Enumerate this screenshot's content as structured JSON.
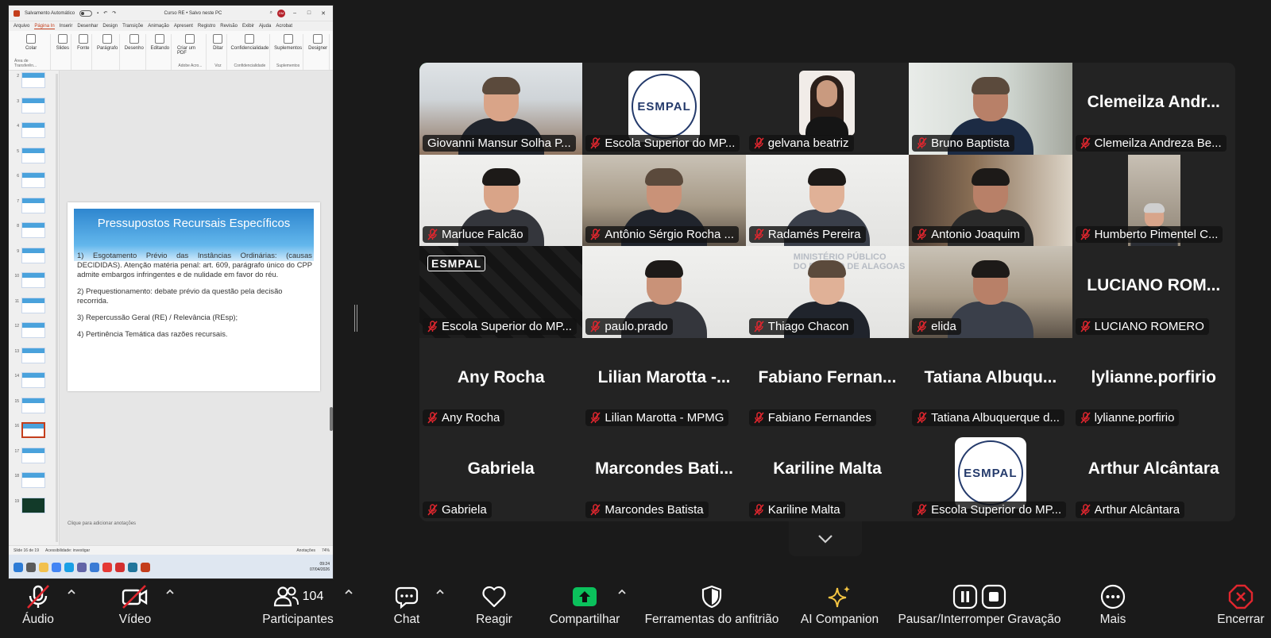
{
  "powerpoint": {
    "title_bar": {
      "autosave_label": "Salvamento Automático",
      "doc_title": "Curso RE • Salvo neste PC",
      "user_initials": "GM"
    },
    "menu_tabs": [
      "Arquivo",
      "Página In",
      "Inserir",
      "Desenhar",
      "Design",
      "Transiçõe",
      "Animação",
      "Apresent",
      "Registro",
      "Revisão",
      "Exibir",
      "Ajuda",
      "Acrobat"
    ],
    "ribbon_groups": [
      {
        "label": "Colar",
        "caption": "Área de Transferên..."
      },
      {
        "label": "Slides",
        "caption": ""
      },
      {
        "label": "Fonte",
        "caption": ""
      },
      {
        "label": "Parágrafo",
        "caption": ""
      },
      {
        "label": "Desenho",
        "caption": ""
      },
      {
        "label": "Editando",
        "caption": ""
      },
      {
        "label": "Criar um PDF",
        "caption": "Adobe Acro..."
      },
      {
        "label": "Ditar",
        "caption": "Voz"
      },
      {
        "label": "Confidencialidade",
        "caption": "Confidencialidade"
      },
      {
        "label": "Suplementos",
        "caption": "Suplementos"
      },
      {
        "label": "Designer",
        "caption": ""
      }
    ],
    "slide_numbers": [
      "2",
      "3",
      "4",
      "5",
      "6",
      "7",
      "8",
      "9",
      "10",
      "11",
      "12",
      "13",
      "14",
      "15",
      "16",
      "17",
      "18",
      "19"
    ],
    "selected_slide": "16",
    "slide": {
      "title": "Pressupostos Recursais Específicos",
      "items": [
        "1) Esgotamento Prévio das Instâncias Ordinárias: (causas DECIDIDAS). Atenção matéria penal: art. 609, parágrafo único do CPP admite embargos infringentes e de nulidade em favor do réu.",
        "2) Prequestionamento: debate prévio da questão pela decisão recorrida.",
        "3) Repercussão Geral (RE) / Relevância (REsp);",
        "4) Pertinência Temática das razões recursais."
      ]
    },
    "notes_placeholder": "Clique para adicionar anotações",
    "status_bar": {
      "slide_counter": "Slide 16 de 19",
      "accessibility": "Acessibilidade: investigar",
      "notes": "Anotações",
      "zoom": "74%"
    },
    "taskbar_clock": {
      "time": "09:24",
      "date": "07/04/2026"
    }
  },
  "gallery": {
    "tiles": [
      {
        "name": "Giovanni Mansur Solha P...",
        "muted": false,
        "active": true,
        "kind": "video",
        "style": "v-office",
        "display": ""
      },
      {
        "name": "Escola Superior do MP...",
        "muted": true,
        "active": false,
        "kind": "logo",
        "style": "",
        "display": ""
      },
      {
        "name": "gelvana beatriz",
        "muted": true,
        "active": false,
        "kind": "photo",
        "style": "",
        "display": ""
      },
      {
        "name": "Bruno Baptista",
        "muted": true,
        "active": false,
        "kind": "video",
        "style": "v-window",
        "display": ""
      },
      {
        "name": "Clemeilza Andreza Be...",
        "muted": true,
        "active": false,
        "kind": "text",
        "style": "",
        "display": "Clemeilza  Andr..."
      },
      {
        "name": "Marluce Falcão",
        "muted": true,
        "active": false,
        "kind": "video",
        "style": "v-white",
        "display": ""
      },
      {
        "name": "Antônio Sérgio Rocha ...",
        "muted": true,
        "active": false,
        "kind": "video",
        "style": "v-room",
        "display": ""
      },
      {
        "name": "Radamés Pereira",
        "muted": true,
        "active": false,
        "kind": "video",
        "style": "v-white",
        "display": ""
      },
      {
        "name": "Antonio Joaquim",
        "muted": true,
        "active": false,
        "kind": "video",
        "style": "v-books",
        "display": ""
      },
      {
        "name": "Humberto Pimentel C...",
        "muted": true,
        "active": false,
        "kind": "small-video",
        "style": "",
        "display": ""
      },
      {
        "name": "Escola Superior do MP...",
        "muted": true,
        "active": false,
        "kind": "esmpal-bg",
        "style": "",
        "display": ""
      },
      {
        "name": "paulo.prado",
        "muted": true,
        "active": false,
        "kind": "video",
        "style": "v-white",
        "display": ""
      },
      {
        "name": "Thiago Chacon",
        "muted": true,
        "active": false,
        "kind": "mp-video",
        "style": "v-white",
        "display": ""
      },
      {
        "name": "elida",
        "muted": true,
        "active": false,
        "kind": "video",
        "style": "v-room",
        "display": ""
      },
      {
        "name": "LUCIANO ROMERO",
        "muted": true,
        "active": false,
        "kind": "text",
        "style": "",
        "display": "LUCIANO  ROM..."
      },
      {
        "name": "Any Rocha",
        "muted": true,
        "active": false,
        "kind": "text",
        "style": "",
        "display": "Any Rocha"
      },
      {
        "name": "Lilian Marotta - MPMG",
        "muted": true,
        "active": false,
        "kind": "text",
        "style": "",
        "display": "Lilian  Marotta  -..."
      },
      {
        "name": "Fabiano Fernandes",
        "muted": true,
        "active": false,
        "kind": "text",
        "style": "",
        "display": "Fabiano  Fernan..."
      },
      {
        "name": "Tatiana Albuquerque d...",
        "muted": true,
        "active": false,
        "kind": "text",
        "style": "",
        "display": "Tatiana  Albuqu..."
      },
      {
        "name": "lylianne.porfirio",
        "muted": true,
        "active": false,
        "kind": "text",
        "style": "",
        "display": "lylianne.porfirio"
      },
      {
        "name": "Gabriela",
        "muted": true,
        "active": false,
        "kind": "text",
        "style": "",
        "display": "Gabriela"
      },
      {
        "name": "Marcondes Batista",
        "muted": true,
        "active": false,
        "kind": "text",
        "style": "",
        "display": "Marcondes  Bati..."
      },
      {
        "name": "Kariline Malta",
        "muted": true,
        "active": false,
        "kind": "text",
        "style": "",
        "display": "Kariline Malta"
      },
      {
        "name": "Escola Superior do MP...",
        "muted": true,
        "active": false,
        "kind": "logo",
        "style": "",
        "display": ""
      },
      {
        "name": "Arthur Alcântara",
        "muted": true,
        "active": false,
        "kind": "text",
        "style": "",
        "display": "Arthur Alcântara"
      }
    ],
    "logo_text": "ESMPAL",
    "mp_watermark": "MINISTÉRIO PÚBLICO\nDO ESTADO DE ALAGOAS"
  },
  "toolbar": {
    "audio": "Áudio",
    "video": "Vídeo",
    "participants": "Participantes",
    "participants_count": "104",
    "chat": "Chat",
    "react": "Reagir",
    "share": "Compartilhar",
    "host_tools": "Ferramentas do anfitrião",
    "ai_companion": "AI Companion",
    "recording": "Pausar/Interromper Gravação",
    "more": "Mais",
    "end": "Encerrar"
  },
  "colors": {
    "active_speaker": "#23d959",
    "muted_red": "#e0262e",
    "share_green": "#0bc15c",
    "ai_gold": "#f5c542",
    "end_red": "#e0262e",
    "ppt_accent": "#c43e1c"
  },
  "icons": [
    "microphone-off-icon",
    "camera-off-icon",
    "participants-icon",
    "chat-icon",
    "heart-icon",
    "share-arrow-icon",
    "shield-icon",
    "sparkle-icon",
    "pause-icon",
    "stop-icon",
    "more-icon",
    "close-icon",
    "chevron-down-icon"
  ]
}
